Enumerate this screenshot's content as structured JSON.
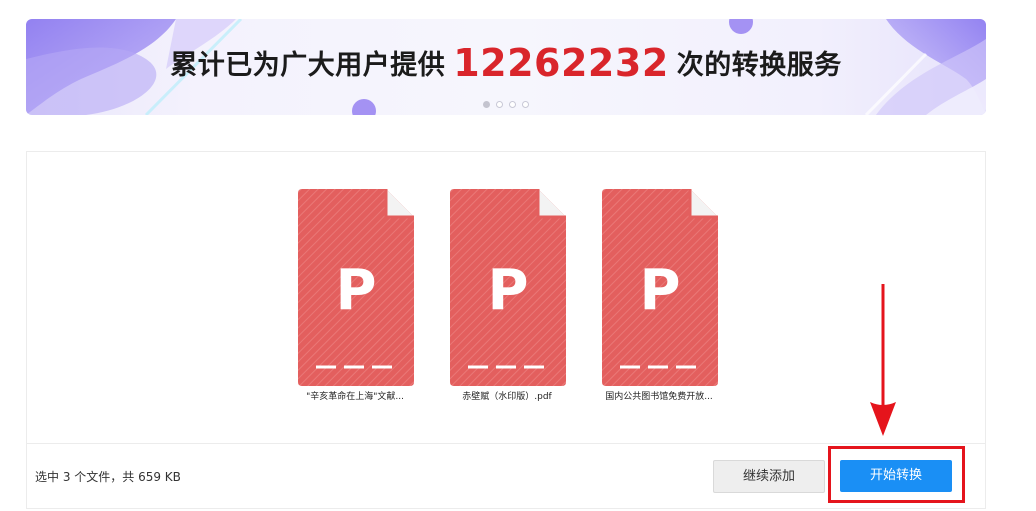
{
  "banner": {
    "prefix": "累计已为广大用户提供",
    "count": "12262232",
    "suffix": "次的转换服务",
    "carousel_dots": 4,
    "active_dot": 0
  },
  "files": [
    {
      "icon_letter": "P",
      "name": "\"辛亥革命在上海\"文献..."
    },
    {
      "icon_letter": "P",
      "name": "赤壁赋（水印版）.pdf"
    },
    {
      "icon_letter": "P",
      "name": "国内公共图书馆免费开放..."
    }
  ],
  "footer": {
    "summary": "选中 3 个文件，共 659 KB",
    "add_label": "继续添加",
    "convert_label": "开始转换"
  },
  "colors": {
    "accent": "#1a8ff5",
    "file_icon": "#e35f5e",
    "count": "#d9252b",
    "highlight": "#e5141c"
  }
}
